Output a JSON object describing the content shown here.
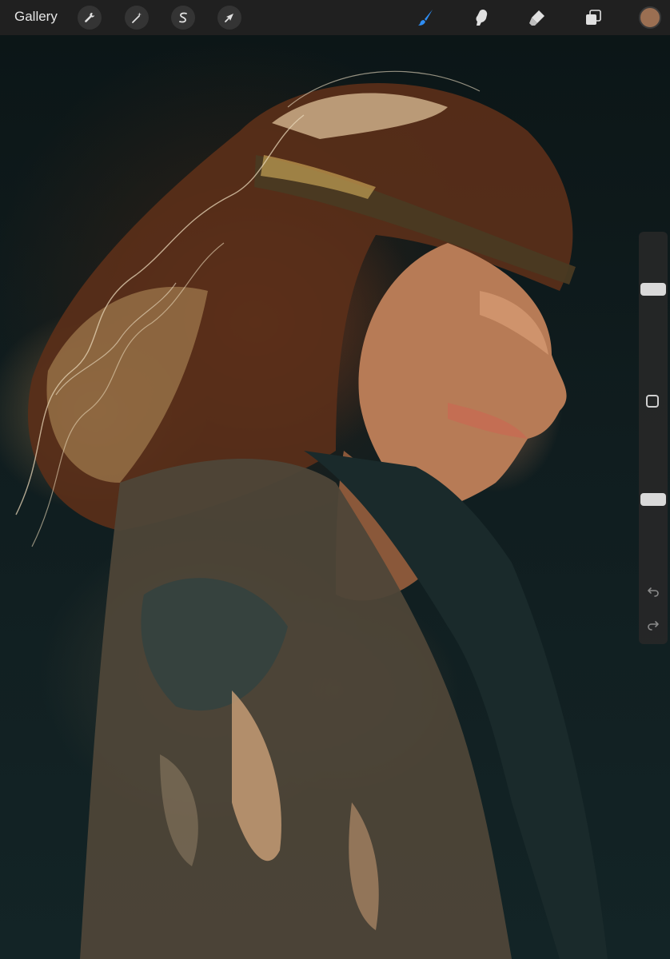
{
  "topbar": {
    "gallery_label": "Gallery",
    "left_tools": [
      {
        "name": "actions",
        "icon": "wrench-icon"
      },
      {
        "name": "adjustments",
        "icon": "magic-wand-icon"
      },
      {
        "name": "selection",
        "icon": "selection-s-icon"
      },
      {
        "name": "transform",
        "icon": "arrow-cursor-icon"
      }
    ],
    "right_tools": [
      {
        "name": "brush",
        "icon": "brush-icon",
        "active": true
      },
      {
        "name": "smudge",
        "icon": "smudge-finger-icon",
        "active": false
      },
      {
        "name": "eraser",
        "icon": "eraser-icon",
        "active": false
      },
      {
        "name": "layers",
        "icon": "layers-icon",
        "active": false
      }
    ],
    "current_color": "#9b6f52"
  },
  "sidebar": {
    "brush_size_level": 0.67,
    "opacity_level": 0.5,
    "undo_icon": "undo-icon",
    "redo_icon": "redo-icon",
    "modify_icon": "square-icon"
  },
  "colors": {
    "toolbar_bg": "#202020",
    "active_tool": "#2f8ef4",
    "icon_light": "#e0e0e0"
  }
}
